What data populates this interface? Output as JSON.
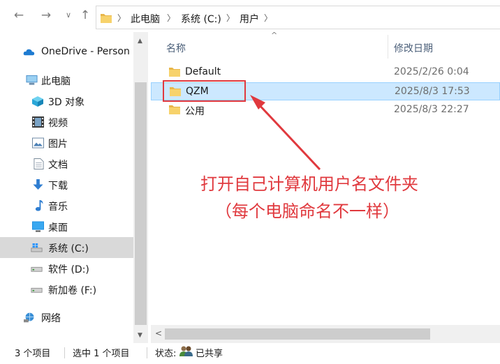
{
  "breadcrumb": {
    "items": [
      "此电脑",
      "系统 (C:)",
      "用户"
    ]
  },
  "sidebar": {
    "items": [
      {
        "label": "OneDrive - Person",
        "icon": "cloud-icon"
      },
      {
        "label": "此电脑",
        "icon": "computer-icon"
      },
      {
        "label": "3D 对象",
        "icon": "cube-icon"
      },
      {
        "label": "视频",
        "icon": "video-icon"
      },
      {
        "label": "图片",
        "icon": "picture-icon"
      },
      {
        "label": "文档",
        "icon": "document-icon"
      },
      {
        "label": "下载",
        "icon": "download-icon"
      },
      {
        "label": "音乐",
        "icon": "music-icon"
      },
      {
        "label": "桌面",
        "icon": "desktop-icon"
      },
      {
        "label": "系统 (C:)",
        "icon": "windows-drive-icon",
        "selected": true
      },
      {
        "label": "软件 (D:)",
        "icon": "drive-icon"
      },
      {
        "label": "新加卷 (F:)",
        "icon": "drive-icon"
      },
      {
        "label": "网络",
        "icon": "network-icon"
      }
    ]
  },
  "columns": {
    "name": "名称",
    "modified": "修改日期"
  },
  "files": [
    {
      "name": "Default",
      "modified": "2025/2/26 0:04"
    },
    {
      "name": "QZM",
      "modified": "2025/8/3 17:53",
      "selected": true
    },
    {
      "name": "公用",
      "modified": "2025/8/3 22:27"
    }
  ],
  "annotation": {
    "line1": "打开自己计算机用户名文件夹",
    "line2": "（每个电脑命名不一样）",
    "color": "#e0393e"
  },
  "status": {
    "count": "3 个项目",
    "selected": "选中 1 个项目",
    "state_label": "状态:",
    "state_value": "已共享"
  },
  "colors": {
    "selection": "#cce8ff",
    "sidebar_selected": "#d9d9d9"
  }
}
